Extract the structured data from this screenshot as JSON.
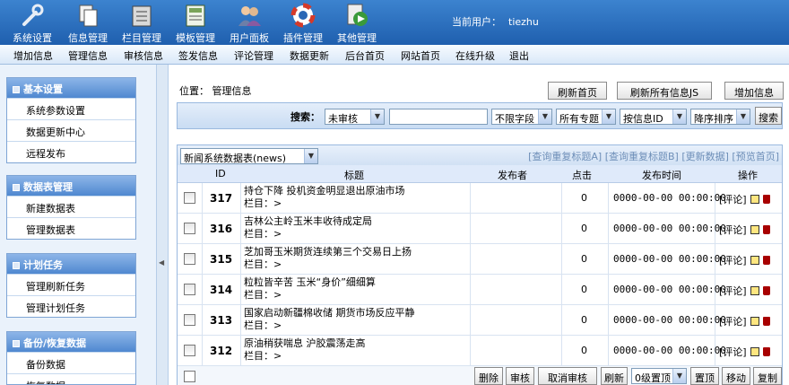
{
  "toolbar": [
    {
      "label": "系统设置",
      "icon": "wrench-icon"
    },
    {
      "label": "信息管理",
      "icon": "documents-icon"
    },
    {
      "label": "栏目管理",
      "icon": "folder-icon"
    },
    {
      "label": "模板管理",
      "icon": "template-icon"
    },
    {
      "label": "用户面板",
      "icon": "users-icon"
    },
    {
      "label": "插件管理",
      "icon": "lifebuoy-icon"
    },
    {
      "label": "其他管理",
      "icon": "media-icon"
    }
  ],
  "user": {
    "label": "当前用户：",
    "name": "tiezhu"
  },
  "menu": [
    "增加信息",
    "管理信息",
    "审核信息",
    "签发信息",
    "评论管理",
    "数据更新",
    "后台首页",
    "网站首页",
    "在线升级",
    "退出"
  ],
  "sidebar": [
    {
      "title": "基本设置",
      "items": [
        "系统参数设置",
        "数据更新中心",
        "远程发布"
      ]
    },
    {
      "title": "数据表管理",
      "items": [
        "新建数据表",
        "管理数据表"
      ]
    },
    {
      "title": "计划任务",
      "items": [
        "管理刷新任务",
        "管理计划任务"
      ]
    },
    {
      "title": "备份/恢复数据",
      "items": [
        "备份数据",
        "恢复数据"
      ]
    }
  ],
  "position": {
    "label": "位置：",
    "value": "管理信息"
  },
  "top_buttons": [
    "刷新首页",
    "刷新所有信息JS",
    "增加信息"
  ],
  "search": {
    "label": "搜索：",
    "status": "未审核",
    "keyword": "",
    "field": "不限字段",
    "topic": "所有专题",
    "sort_by": "按信息ID",
    "order": "降序排序",
    "button": "搜索"
  },
  "table_select": "新闻系统数据表(news)",
  "table_links": "[查询重复标题A] [查询重复标题B] [更新数据] [预览首页]",
  "columns": [
    "ID",
    "标题",
    "发布者",
    "点击",
    "发布时间",
    "操作"
  ],
  "rows": [
    {
      "id": "317",
      "title": "持仓下降 投机资金明显退出原油市场",
      "column": "栏目：>",
      "clicks": "0",
      "time": "0000-00-00 00:00:00",
      "op": "[评论]"
    },
    {
      "id": "316",
      "title": "吉林公主岭玉米丰收待成定局",
      "column": "栏目：>",
      "clicks": "0",
      "time": "0000-00-00 00:00:00",
      "op": "[评论]"
    },
    {
      "id": "315",
      "title": "芝加哥玉米期货连续第三个交易日上扬",
      "column": "栏目：>",
      "clicks": "0",
      "time": "0000-00-00 00:00:00",
      "op": "[评论]"
    },
    {
      "id": "314",
      "title": "粒粒皆辛苦 玉米“身价”细细算",
      "column": "栏目：>",
      "clicks": "0",
      "time": "0000-00-00 00:00:00",
      "op": "[评论]"
    },
    {
      "id": "313",
      "title": "国家启动新疆棉收储 期货市场反应平静",
      "column": "栏目：>",
      "clicks": "0",
      "time": "0000-00-00 00:00:00",
      "op": "[评论]"
    },
    {
      "id": "312",
      "title": "原油稍获喘息 沪胶震荡走高",
      "column": "栏目：>",
      "clicks": "0",
      "time": "0000-00-00 00:00:00",
      "op": "[评论]"
    }
  ],
  "footer": {
    "delete": "删除",
    "audit": "审核",
    "unaudit": "取消审核",
    "refresh": "刷新",
    "top_level": "0级置顶",
    "set_top": "置顶",
    "move": "移动",
    "copy": "复制"
  }
}
